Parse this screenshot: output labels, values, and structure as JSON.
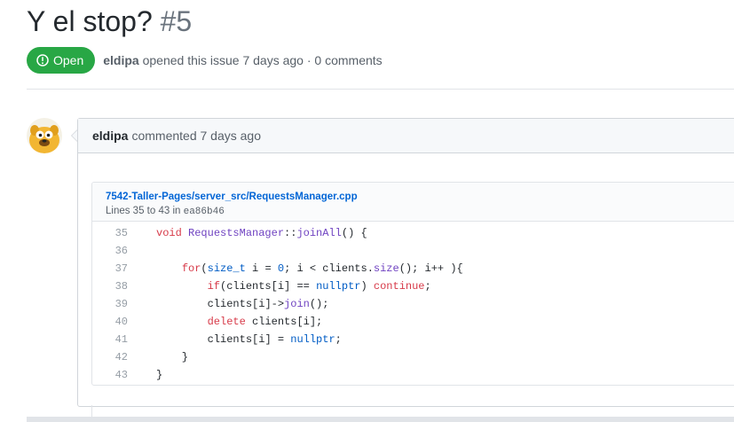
{
  "issue": {
    "title": "Y el stop?",
    "number": "#5",
    "state": "Open",
    "author": "eldipa",
    "meta_text": "opened this issue 7 days ago · 0 comments"
  },
  "comment": {
    "author": "eldipa",
    "timestamp": "commented 7 days ago",
    "snippet": {
      "file_path": "7542-Taller-Pages/server_src/RequestsManager.cpp",
      "lines_info": "Lines 35 to 43 in",
      "commit_sha": "ea86b46",
      "lines": [
        {
          "num": "35",
          "code": "void RequestsManager::joinAll() {"
        },
        {
          "num": "36",
          "code": ""
        },
        {
          "num": "37",
          "code": "    for(size_t i = 0; i < clients.size(); i++ ){"
        },
        {
          "num": "38",
          "code": "        if(clients[i] == nullptr) continue;"
        },
        {
          "num": "39",
          "code": "        clients[i]->join();"
        },
        {
          "num": "40",
          "code": "        delete clients[i];"
        },
        {
          "num": "41",
          "code": "        clients[i] = nullptr;"
        },
        {
          "num": "42",
          "code": "    }"
        },
        {
          "num": "43",
          "code": "}"
        }
      ]
    }
  },
  "colors": {
    "open_green": "#28a745",
    "link_blue": "#0366d6",
    "keyword_red": "#d73a49",
    "function_purple": "#6f42c1",
    "constant_blue": "#005cc5"
  },
  "icons": {
    "state": "issue-opened-icon",
    "avatar": "jake-avatar"
  }
}
